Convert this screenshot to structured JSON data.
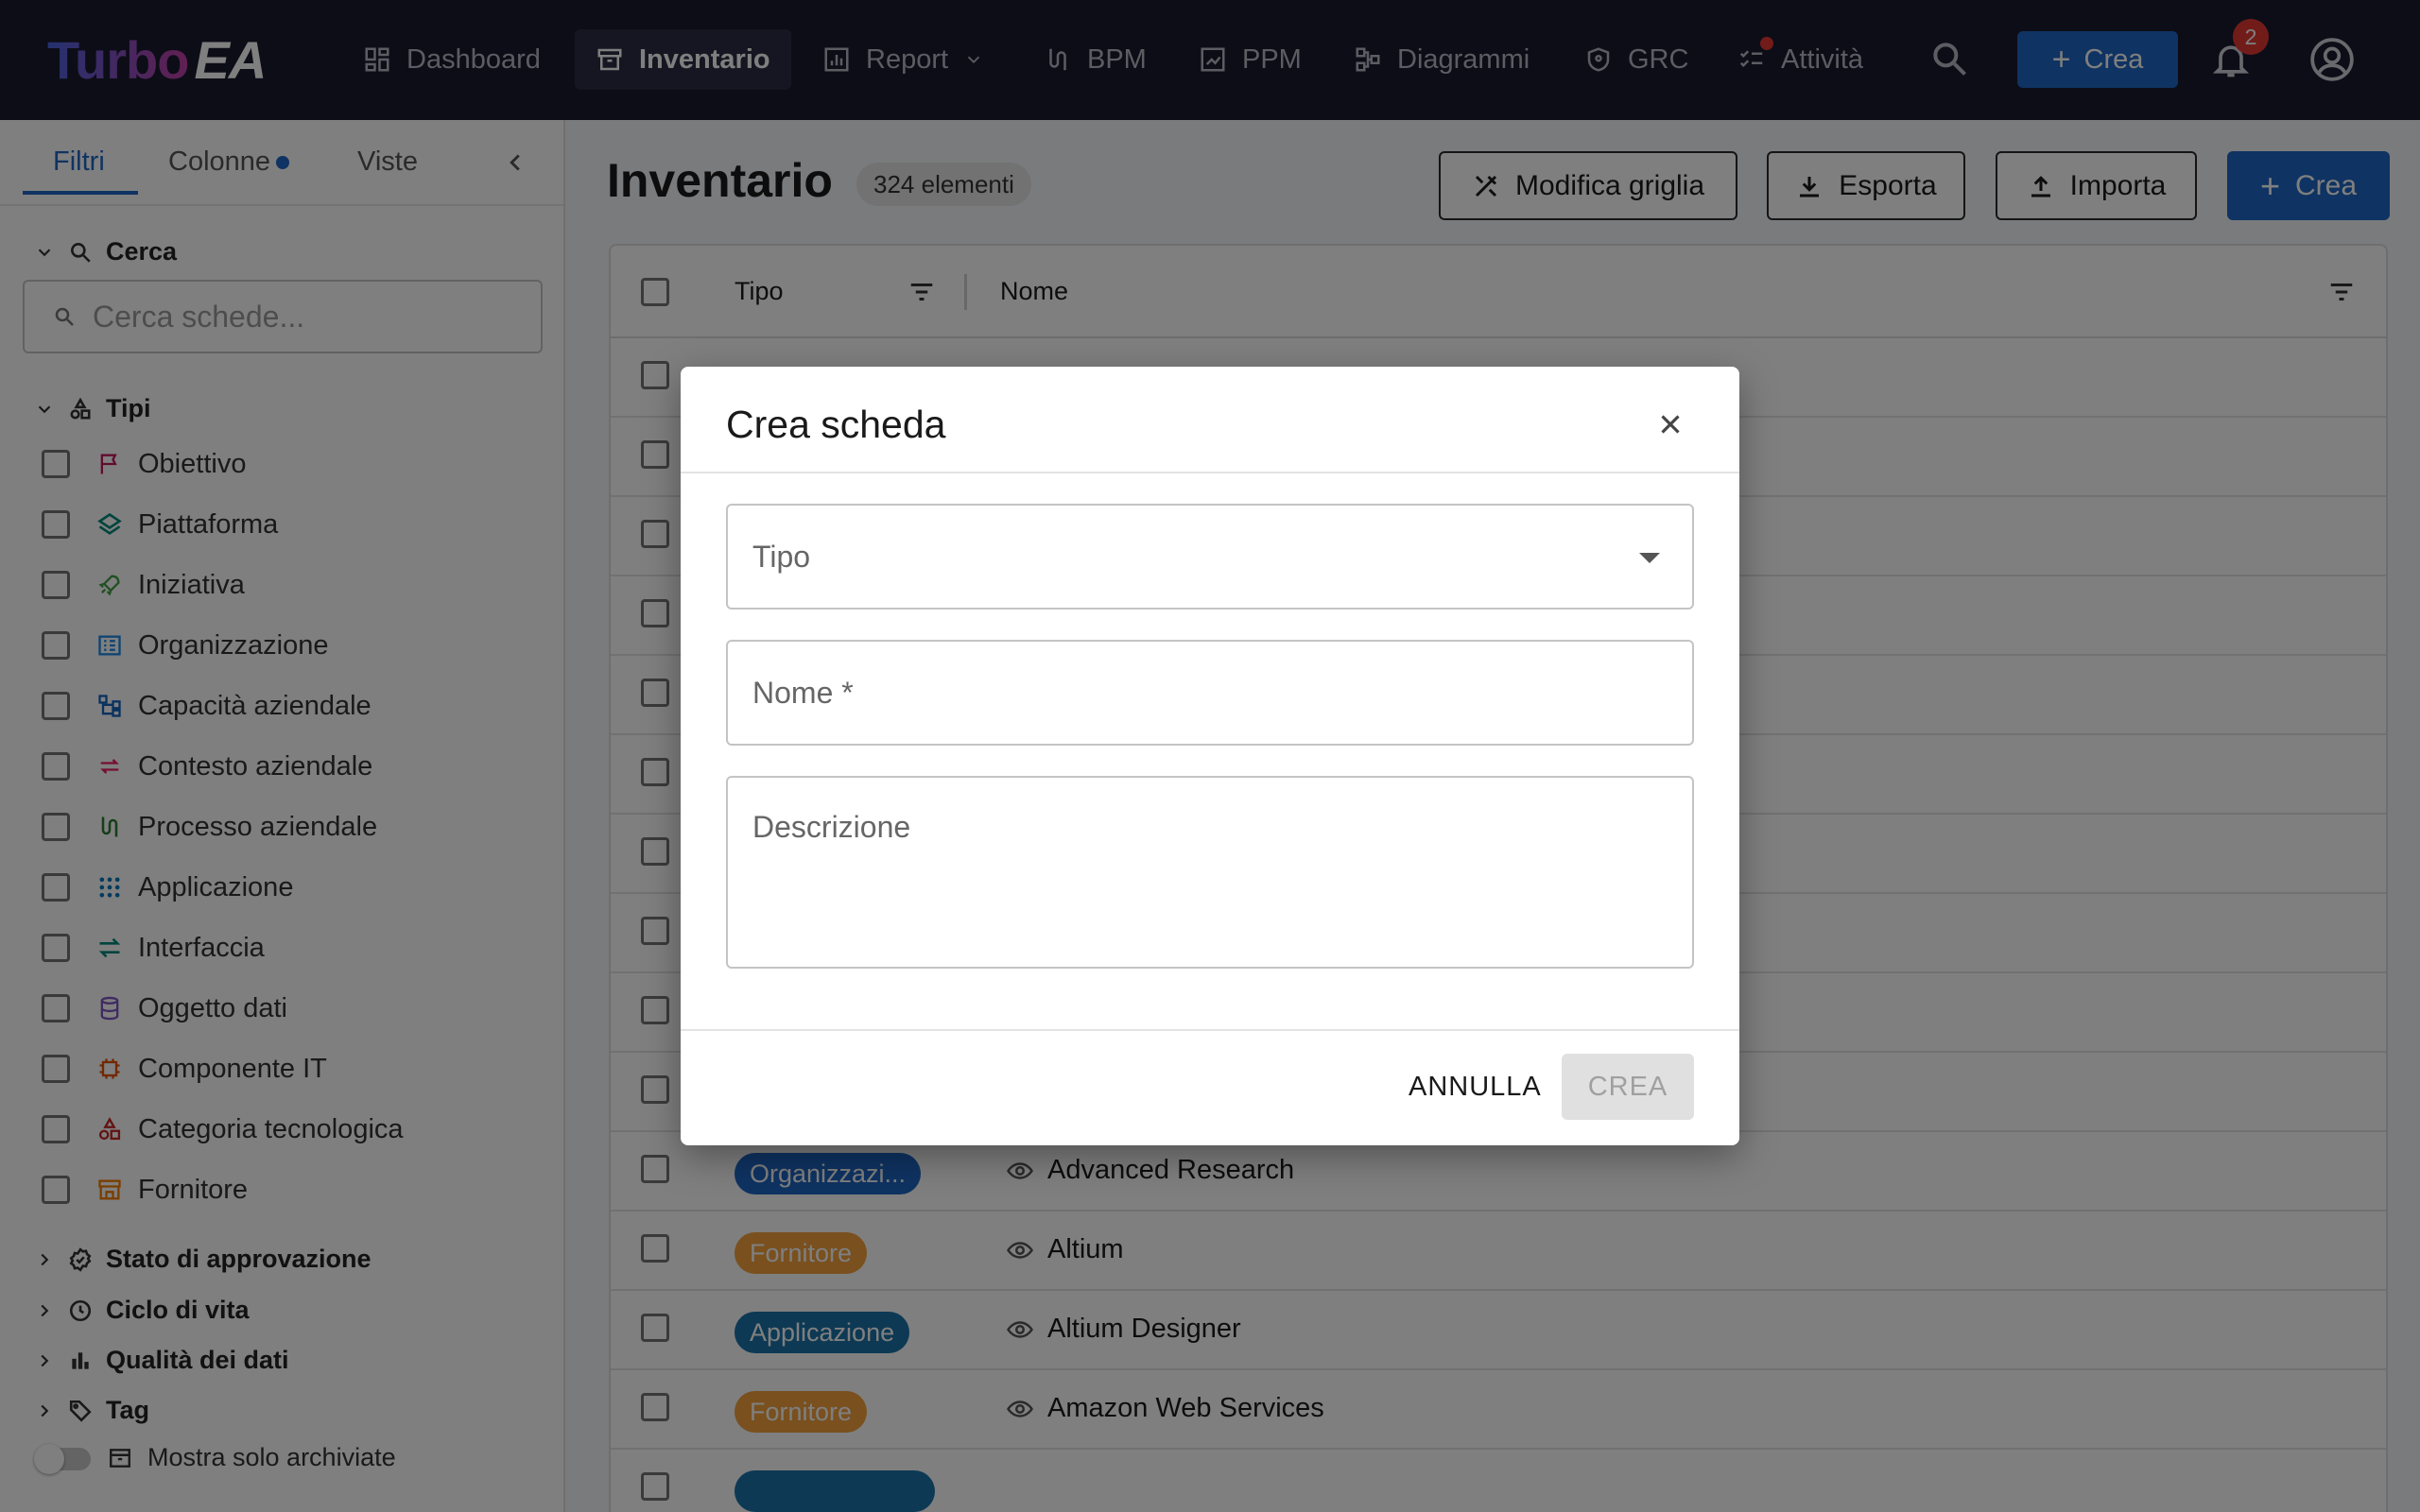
{
  "app": {
    "logo_turbo": "Turbo",
    "logo_ea": "EA"
  },
  "nav": {
    "items": [
      {
        "label": "Dashboard",
        "icon": "dashboard-icon"
      },
      {
        "label": "Inventario",
        "icon": "archive-icon",
        "active": true
      },
      {
        "label": "Report",
        "icon": "report-icon",
        "has_dropdown": true
      },
      {
        "label": "BPM",
        "icon": "process-icon"
      },
      {
        "label": "PPM",
        "icon": "ppm-icon"
      },
      {
        "label": "Diagrammi",
        "icon": "diagram-icon"
      },
      {
        "label": "GRC",
        "icon": "shield-icon"
      },
      {
        "label": "Attività",
        "icon": "tasks-icon",
        "has_dot": true
      }
    ],
    "create_label": "Crea",
    "notification_count": "2"
  },
  "sidebar": {
    "tabs": [
      {
        "label": "Filtri",
        "active": true
      },
      {
        "label": "Colonne",
        "has_dot": true
      },
      {
        "label": "Viste"
      }
    ],
    "search_section": "Cerca",
    "search_placeholder": "Cerca schede...",
    "types_section": "Tipi",
    "types": [
      {
        "label": "Obiettivo",
        "icon": "flag-icon",
        "color": "#c2185b"
      },
      {
        "label": "Piattaforma",
        "icon": "layers-icon",
        "color": "#00897b"
      },
      {
        "label": "Iniziativa",
        "icon": "rocket-icon",
        "color": "#43a047"
      },
      {
        "label": "Organizzazione",
        "icon": "building-icon",
        "color": "#1e88e5"
      },
      {
        "label": "Capacità aziendale",
        "icon": "hierarchy-icon",
        "color": "#1565c0"
      },
      {
        "label": "Contesto aziendale",
        "icon": "swap-icon",
        "color": "#e91e63"
      },
      {
        "label": "Processo aziendale",
        "icon": "process-icon",
        "color": "#2e7d32"
      },
      {
        "label": "Applicazione",
        "icon": "apps-icon",
        "color": "#0277bd"
      },
      {
        "label": "Interfaccia",
        "icon": "exchange-icon",
        "color": "#00897b"
      },
      {
        "label": "Oggetto dati",
        "icon": "database-icon",
        "color": "#7e57c2"
      },
      {
        "label": "Componente IT",
        "icon": "chip-icon",
        "color": "#e65100"
      },
      {
        "label": "Categoria tecnologica",
        "icon": "category-icon",
        "color": "#c62828"
      },
      {
        "label": "Fornitore",
        "icon": "store-icon",
        "color": "#f57c00"
      }
    ],
    "collapsed_sections": [
      {
        "label": "Stato di approvazione",
        "icon": "approval-icon"
      },
      {
        "label": "Ciclo di vita",
        "icon": "clock-icon"
      },
      {
        "label": "Qualità dei dati",
        "icon": "bar-chart-icon"
      },
      {
        "label": "Tag",
        "icon": "tag-icon"
      }
    ],
    "archived_toggle_label": "Mostra solo archiviate"
  },
  "main": {
    "title": "Inventario",
    "count": "324 elementi",
    "buttons": {
      "edit_grid": "Modifica griglia",
      "export": "Esporta",
      "import": "Importa",
      "create": "Crea"
    },
    "columns": [
      "Tipo",
      "Nome"
    ],
    "rows": [
      {
        "type": "Organizzazi...",
        "type_color": "#1f67c4",
        "name": "Advanced Research"
      },
      {
        "type": "Fornitore",
        "type_color": "#f2a03d",
        "name": "Altium"
      },
      {
        "type": "Applicazione",
        "type_color": "#1a73a8",
        "name": "Altium Designer"
      },
      {
        "type": "Fornitore",
        "type_color": "#f2a03d",
        "name": "Amazon Web Services"
      }
    ]
  },
  "modal": {
    "title": "Crea scheda",
    "type_label": "Tipo",
    "name_label": "Nome *",
    "description_label": "Descrizione",
    "cancel": "ANNULLA",
    "create": "CREA"
  }
}
